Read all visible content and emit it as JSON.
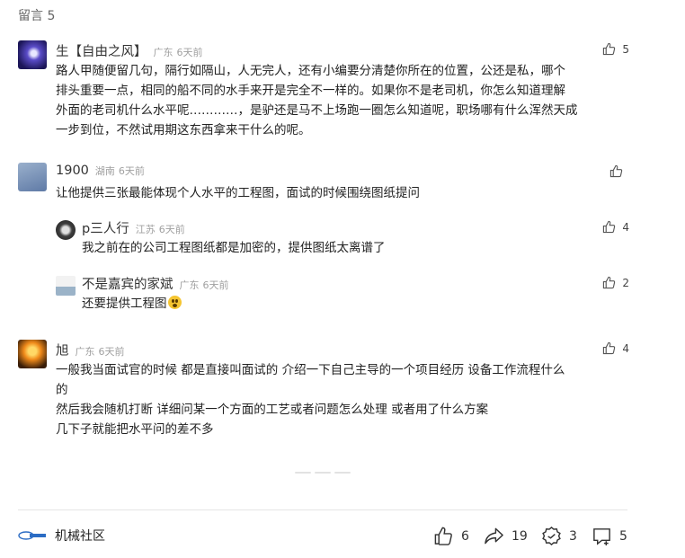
{
  "header": {
    "title": "留言 5"
  },
  "comments": [
    {
      "user": "生【自由之风】",
      "location": "广东",
      "time": "6天前",
      "likes": "5",
      "lines": [
        "路人甲随便留几句，隔行如隔山，人无完人，还有小编要分清楚你所在的位置，公还是私，哪个",
        "排头重要一点，相同的船不同的水手来开是完全不一样的。如果你不是老司机，你怎么知道理解",
        "外面的老司机什么水平呢…………，是驴还是马不上场跑一圈怎么知道呢，职场哪有什么浑然天成",
        "一步到位，不然试用期这东西拿来干什么的呢。"
      ]
    },
    {
      "user": "1900",
      "location": "湖南",
      "time": "6天前",
      "likes": "",
      "lines": [
        "让他提供三张最能体现个人水平的工程图，面试的时候围绕图纸提问"
      ],
      "replies": [
        {
          "user": "p三人行",
          "location": "江苏",
          "time": "6天前",
          "likes": "4",
          "text": "我之前在的公司工程图纸都是加密的，提供图纸太离谱了"
        },
        {
          "user": "不是嘉宾的家斌",
          "location": "广东",
          "time": "6天前",
          "likes": "2",
          "text": "还要提供工程图"
        }
      ]
    },
    {
      "user": "旭",
      "location": "广东",
      "time": "6天前",
      "likes": "4",
      "lines": [
        "一般我当面试官的时候  都是直接叫面试的 介绍一下自己主导的一个项目经历 设备工作流程什么",
        "的",
        "然后我会随机打断  详细问某一个方面的工艺或者问题怎么处理 或者用了什么方案",
        "几下子就能把水平问的差不多"
      ]
    }
  ],
  "footer": {
    "community": "机械社区",
    "likes": "6",
    "shares": "19",
    "recommends": "3",
    "comments": "5"
  },
  "colors": {
    "text": "#222222",
    "muted": "#a0a0a0",
    "divider": "#e5e5e5"
  },
  "icons": [
    "thumb-up-icon",
    "share-icon",
    "recommend-icon",
    "comment-icon"
  ]
}
